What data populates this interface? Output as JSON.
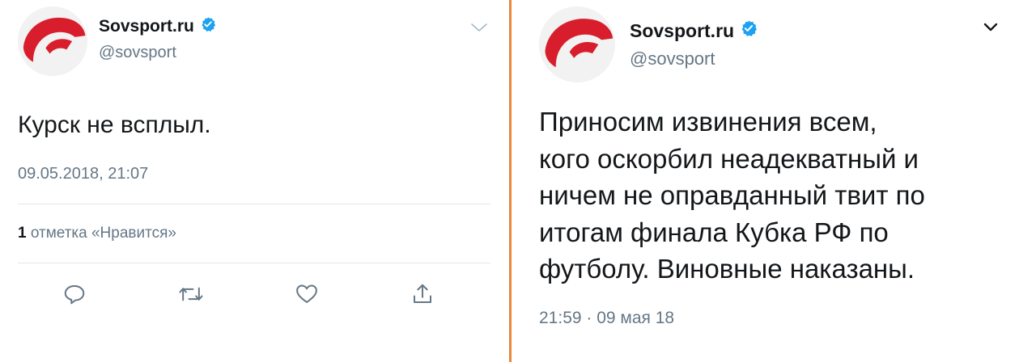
{
  "left_tweet": {
    "name": "Sovsport.ru",
    "handle": "@sovsport",
    "text": "Курск не всплыл.",
    "timestamp": "09.05.2018, 21:07",
    "likes_count": "1",
    "likes_label": "отметка «Нравится»",
    "actions": [
      "reply",
      "retweet",
      "like",
      "share"
    ]
  },
  "right_tweet": {
    "name": "Sovsport.ru",
    "handle": "@sovsport",
    "text_lines": [
      "Приносим извинения всем,",
      "кого оскорбил неадекватный и",
      "ничем не оправданный твит по",
      "итогам финала Кубка РФ по",
      "футболу. Виновные наказаны."
    ],
    "timestamp": "21:59 · 09 мая 18"
  },
  "colors": {
    "divider": "#e8883a",
    "brand_red": "#d81e2c",
    "verified_blue": "#1da1f2",
    "secondary_text": "#657786"
  },
  "icons": [
    "sovsport-logo-icon",
    "verified-badge-icon",
    "chevron-down-icon",
    "reply-icon",
    "retweet-icon",
    "like-icon",
    "share-icon"
  ]
}
